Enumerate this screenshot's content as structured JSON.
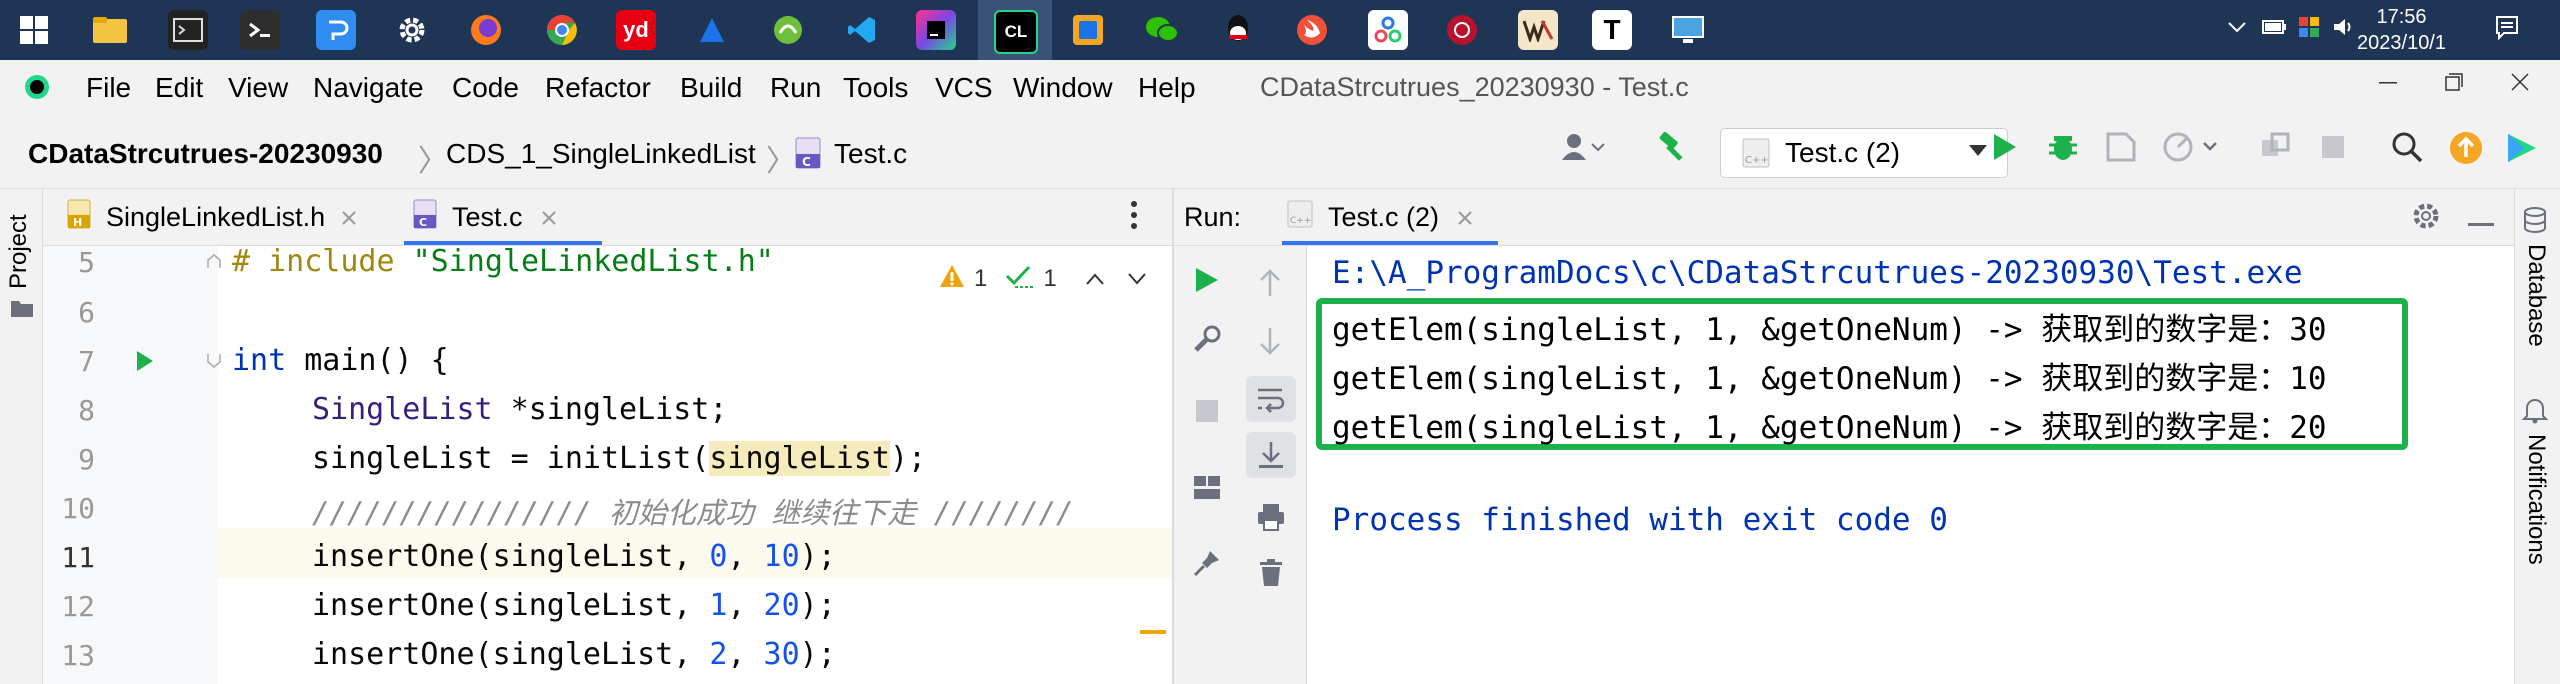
{
  "taskbar": {
    "icons": [
      "windows-start",
      "file-explorer",
      "terminal",
      "powershell",
      "input-method",
      "settings",
      "firefox",
      "chrome",
      "youdao",
      "app-blue",
      "app-green",
      "vscode",
      "jetbrains-toolbox",
      "clion",
      "app-orange",
      "wechat",
      "qq",
      "swift",
      "app-network",
      "app-red",
      "wps",
      "typora",
      "remote-desktop"
    ],
    "youdao_label": "yd",
    "clion_label": "CL",
    "typora_label": "T",
    "time": "17:56",
    "date": "2023/10/1"
  },
  "menu": {
    "items": [
      "File",
      "Edit",
      "View",
      "Navigate",
      "Code",
      "Refactor",
      "Build",
      "Run",
      "Tools",
      "VCS",
      "Window",
      "Help"
    ],
    "window_title": "CDataStrcutrues_20230930 - Test.c"
  },
  "navbar": {
    "breadcrumbs": [
      "CDataStrcutrues-20230930",
      "CDS_1_SingleLinkedList",
      "Test.c"
    ],
    "run_config": "Test.c (2)"
  },
  "tool_windows": {
    "project": "Project",
    "database": "Database",
    "notifications": "Notifications"
  },
  "editor": {
    "tabs": [
      {
        "label": "SingleLinkedList.h",
        "type": "H"
      },
      {
        "label": "Test.c",
        "type": "C",
        "active": true
      }
    ],
    "warnings": "1",
    "weak_warnings": "1",
    "line_numbers": [
      "5",
      "6",
      "7",
      "8",
      "9",
      "10",
      "11",
      "12",
      "13"
    ],
    "lines": {
      "l5_pp": "# include",
      "l5_str": "\"SingleLinkedList.h\"",
      "l7_kw": "int",
      "l7_rest": " main() {",
      "l8_type": "SingleList",
      "l8_rest": " *singleList;",
      "l9_a": "singleList = initList(",
      "l9_hl": "singleList",
      "l9_b": ");",
      "l10_cmt": "//////////////// 初始化成功 继续往下走 ////////",
      "l11_a": "insertOne(singleList, ",
      "l11_n1": "0",
      "l11_b": ", ",
      "l11_n2": "10",
      "l11_c": ");",
      "l12_a": "insertOne(singleList, ",
      "l12_n1": "1",
      "l12_b": ", ",
      "l12_n2": "20",
      "l12_c": ");",
      "l13_a": "insertOne(singleList, ",
      "l13_n1": "2",
      "l13_b": ", ",
      "l13_n2": "30",
      "l13_c": ");"
    }
  },
  "run": {
    "label": "Run:",
    "tab": "Test.c (2)",
    "output": {
      "path": "E:\\A_ProgramDocs\\c\\CDataStrcutrues-20230930\\Test.exe",
      "lines": [
        "getElem(singleList, 1, &getOneNum) -> 获取到的数字是：30",
        "getElem(singleList, 1, &getOneNum) -> 获取到的数字是：10",
        "getElem(singleList, 1, &getOneNum) -> 获取到的数字是：20"
      ],
      "exit": "Process finished with exit code 0"
    }
  },
  "colors": {
    "taskbar": "#1f3555",
    "highlight_box": "#1db14b",
    "output_blue": "#0033b3",
    "run_green": "#1db14b"
  }
}
